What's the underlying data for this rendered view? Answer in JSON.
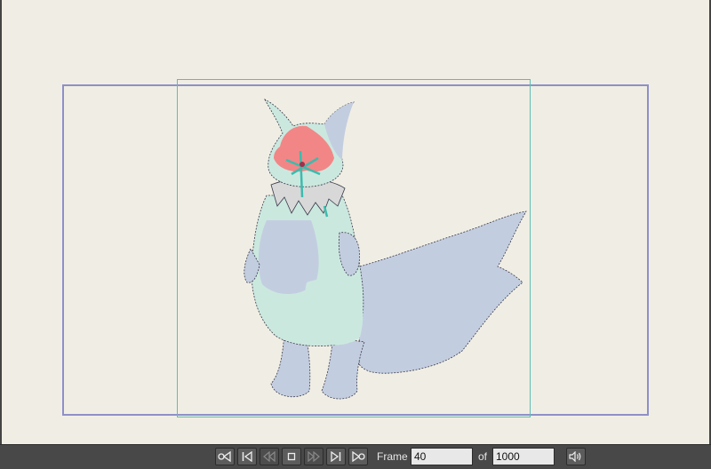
{
  "canvas": {
    "background": "#f0eee4",
    "outer_frame_color": "#8f8fc9",
    "inner_frame_color": "#5fbcb4"
  },
  "playback": {
    "buttons": [
      {
        "name": "first-frame-button",
        "icon": "first-frame-icon",
        "enabled": true
      },
      {
        "name": "previous-frame-button",
        "icon": "previous-frame-icon",
        "enabled": true
      },
      {
        "name": "play-backward-button",
        "icon": "play-backward-icon",
        "enabled": false
      },
      {
        "name": "stop-button",
        "icon": "stop-icon",
        "enabled": true
      },
      {
        "name": "play-forward-button",
        "icon": "play-forward-icon",
        "enabled": false
      },
      {
        "name": "next-frame-button",
        "icon": "next-frame-icon",
        "enabled": true
      },
      {
        "name": "last-frame-button",
        "icon": "last-frame-icon",
        "enabled": true
      }
    ],
    "frame_label": "Frame",
    "current_frame": "40",
    "of_label": "of",
    "total_frames": "1000",
    "volume_icon": "speaker-icon"
  }
}
